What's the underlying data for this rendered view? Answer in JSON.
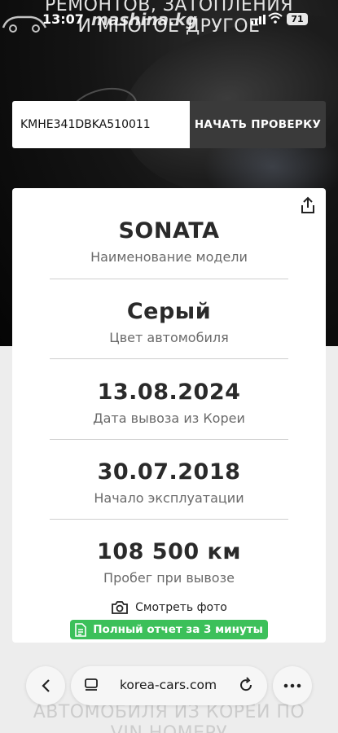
{
  "status_bar": {
    "time": "13:07",
    "brand_watermark": "mashina.kg",
    "battery": "71"
  },
  "hero": {
    "title_line1": "РЕМОНТОВ, ЗАТОПЛЕНИЯ",
    "title_line2": "И МНОГОЕ ДРУГОЕ"
  },
  "vin_form": {
    "vin_value": "KMHE341DBKA510011",
    "button_label": "НАЧАТЬ ПРОВЕРКУ"
  },
  "card": {
    "items": [
      {
        "value": "SONATA",
        "label": "Наименование модели"
      },
      {
        "value": "Серый",
        "label": "Цвет автомобиля"
      },
      {
        "value": "13.08.2024",
        "label": "Дата вывоза из Кореи"
      },
      {
        "value": "30.07.2018",
        "label": "Начало эксплуатации"
      },
      {
        "value": "108 500 км",
        "label": "Пробег при вывозе"
      }
    ],
    "photo_link": "Смотреть фото",
    "report_badge": "Полный отчет за 3 минуты"
  },
  "browser": {
    "url": "korea-cars.com"
  },
  "footer": {
    "text_line1": "АВТОМОБИЛЯ ИЗ КОРЕИ ПО",
    "text_line2": "VIN НОМЕРУ"
  },
  "colors": {
    "accent_green": "#3cc05a",
    "button_dark": "#3a3a3a",
    "hero_dark": "#0a0a0a"
  }
}
